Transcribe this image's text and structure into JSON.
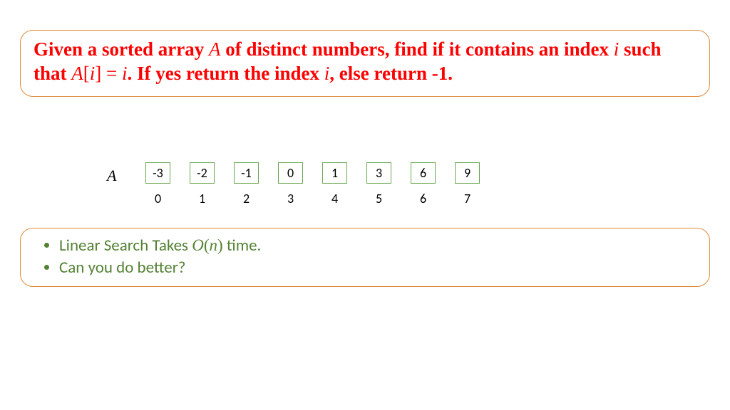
{
  "problem": {
    "part1": "Given a sorted array ",
    "varA1": "A",
    "part2": " of distinct numbers, find if it contains an index ",
    "vari1": "i",
    "part3": " such that ",
    "eqA": "A",
    "eqBracketOpen": "[",
    "eqI": "i",
    "eqBracketClose": "]",
    "eqEquals": " = ",
    "eqI2": "i",
    "part4": ". If yes return the index ",
    "vari2": "i",
    "part5": ", else return -1."
  },
  "array": {
    "label": "A",
    "values": [
      "-3",
      "-2",
      "-1",
      "0",
      "1",
      "3",
      "6",
      "9"
    ],
    "indices": [
      "0",
      "1",
      "2",
      "3",
      "4",
      "5",
      "6",
      "7"
    ]
  },
  "notes": {
    "item1_pre": "Linear Search Takes ",
    "item1_bigO_O": "O",
    "item1_bigO_paren": "(",
    "item1_bigO_n": "n",
    "item1_bigO_close": ")",
    "item1_post": " time.",
    "item2": "Can you do better?"
  }
}
